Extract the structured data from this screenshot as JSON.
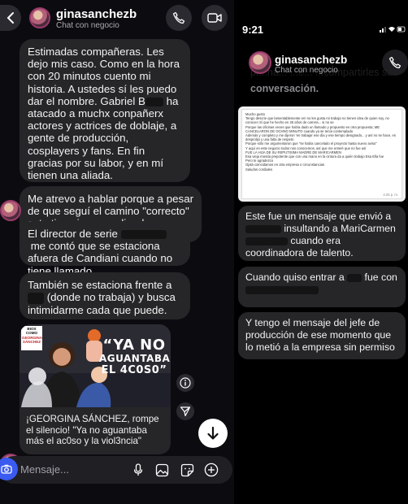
{
  "left_chat": {
    "username": "ginasanchezb",
    "subtitle": "Chat con negocio",
    "messages": [
      "Estimadas compañeras. Les dejo mis caso. Como en la hora con 20 minutos cuento mi historia. A ustedes sí les puedo dar el nombre. Gabriel B",
      "ha atacado a muchx conpañerx actores y actrices de doblaje, a gente de producción, cosplayers y fans. En fin gracias por su labor, y en mí tienen una aliada.",
      "Me atrevo a hablar porque a pesar de que seguí el camino \"correcto\" este tipo sigue asediando e intimidando.",
      "El director de serie",
      "me contó que se estaciona afuera de Candiani cuando no tiene llamado.",
      "También se estaciona frente a",
      "(donde no trabaja) y busca intimidarme cada que puede."
    ],
    "card": {
      "badge_line1": "BIOS COMO",
      "badge_line2": "GEORGINA",
      "badge_line3": "SÁNCHEZ",
      "headline_line1": "“YA NO",
      "headline_line2": "AGUANTABA",
      "headline_line3": "EL 4C0S0”",
      "caption": "¡GEORGINA SÁNCHEZ, rompe el silencio! \"Ya no aguantaba más el ac0so y la viol3ncia\""
    },
    "composer_placeholder": "Mensaje...",
    "icons": [
      "back-icon",
      "phone-icon",
      "video-icon",
      "info-icon",
      "share-icon",
      "arrow-down-icon",
      "camera-icon",
      "microphone-icon",
      "gallery-icon",
      "sticker-icon",
      "plus-icon"
    ]
  },
  "right_chat": {
    "status_time": "9:21",
    "ghost_text_line1": "pr...na... ...e... ...compartirles su",
    "ghost_text_line2": "conversación.",
    "username": "ginasanchezb",
    "subtitle": "Chat con negocio",
    "screenshot_text": [
      "Mucho gusto",
      "Tengo descrie que lamentablemente en! no les gusta mi trabajo no tienen idea de quien soy, no conocen Sí que he hecho en 25 años de carrera... si no se",
      "Porque las oficinas veces que había dado un llamado y propuesto en otra propuesta; ME CANCELARON DE OCHNO MINUTO cuando ya se tenía contemplado",
      "Además y completo y me dijeron 'en trabajar ese día y ese tiempo designado... y así no se hace, es desprolijo y una falta de respeto",
      "Porque sólo me argumentaron que \"se había cancelado el proyecto hasta nuevo aviso\"",
      "Y aquí en este negocio todos nos conocemos, así que me enteré que no fue así",
      "FUE LA HIJA DE SU REPUTISIMA MADRE DE MARICARMEN",
      "Esa vieja mierda prepotente que con una mano en la cintura da a quién trabajo Esa Ella fue",
      "Pero te agradezco",
      "Ojalá coincidamos en otra empresa o circunstancias",
      "Saludos cordiales"
    ],
    "screenshot_time": "4:25 p. m.",
    "msg1_a": "Este fue un mensaje que envió a",
    "msg1_b": "insultando a MariCarmen",
    "msg1_c": "cuando era coordinadora de talento.",
    "msg2_a": "Cuando quiso entrar a",
    "msg2_b": "fue con",
    "msg3": "Y tengo el mensaje del jefe de producción de ese momento que lo metió a la empresa sin permiso"
  }
}
